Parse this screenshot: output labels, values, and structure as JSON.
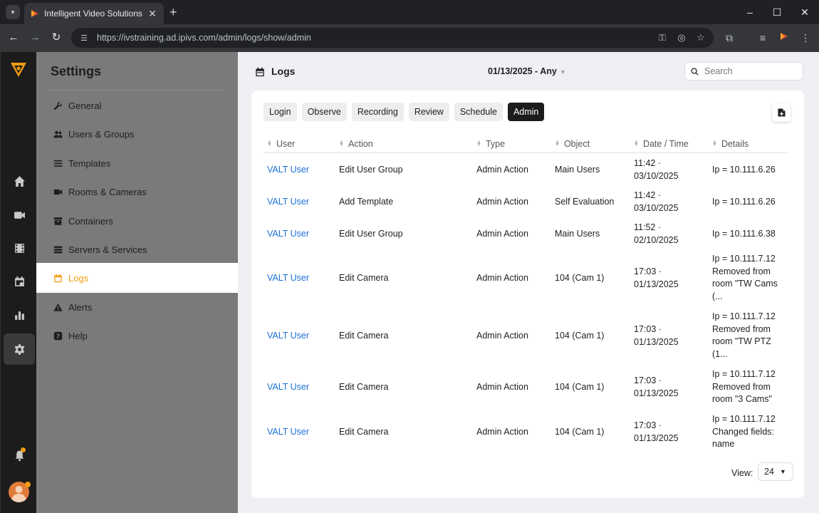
{
  "browser": {
    "tab_title": "Intelligent Video Solutions",
    "url": "https://ivstraining.ad.ipivs.com/admin/logs/show/admin",
    "icons": [
      "tab-dropdown-icon",
      "close-tab-icon",
      "new-tab-icon",
      "minimize-icon",
      "maximize-icon",
      "close-window-icon",
      "back-icon",
      "forward-icon",
      "reload-icon",
      "site-settings-icon",
      "key-icon",
      "eye-off-icon",
      "star-icon",
      "extensions-icon",
      "media-icon",
      "app-icon",
      "menu-icon"
    ]
  },
  "sidebar": {
    "title": "Settings",
    "items": [
      {
        "label": "General",
        "icon": "wrench-icon"
      },
      {
        "label": "Users & Groups",
        "icon": "users-icon"
      },
      {
        "label": "Templates",
        "icon": "list-icon"
      },
      {
        "label": "Rooms & Cameras",
        "icon": "camera-icon"
      },
      {
        "label": "Containers",
        "icon": "archive-icon"
      },
      {
        "label": "Servers & Services",
        "icon": "server-icon"
      },
      {
        "label": "Logs",
        "icon": "calendar-icon",
        "active": true
      },
      {
        "label": "Alerts",
        "icon": "warning-icon"
      },
      {
        "label": "Help",
        "icon": "help-icon"
      }
    ]
  },
  "header": {
    "title": "Logs",
    "date_range": "01/13/2025 - Any",
    "search_placeholder": "Search"
  },
  "tabs": [
    {
      "label": "Login"
    },
    {
      "label": "Observe"
    },
    {
      "label": "Recording"
    },
    {
      "label": "Review"
    },
    {
      "label": "Schedule"
    },
    {
      "label": "Admin",
      "active": true
    }
  ],
  "table": {
    "columns": [
      "User",
      "Action",
      "Type",
      "Object",
      "Date / Time",
      "Details"
    ],
    "rows": [
      {
        "user": "VALT User",
        "action": "Edit User Group",
        "type": "Admin Action",
        "object": "Main Users",
        "time": "11:42 ·",
        "date": "03/10/2025",
        "details": [
          "Ip = 10.111.6.26"
        ]
      },
      {
        "user": "VALT User",
        "action": "Add Template",
        "type": "Admin Action",
        "object": "Self Evaluation",
        "time": "11:42 ·",
        "date": "03/10/2025",
        "details": [
          "Ip = 10.111.6.26"
        ]
      },
      {
        "user": "VALT User",
        "action": "Edit User Group",
        "type": "Admin Action",
        "object": "Main Users",
        "time": "11:52 ·",
        "date": "02/10/2025",
        "details": [
          "Ip = 10.111.6.38"
        ]
      },
      {
        "user": "VALT User",
        "action": "Edit Camera",
        "type": "Admin Action",
        "object": "104 (Cam 1)",
        "time": "17:03 ·",
        "date": "01/13/2025",
        "details": [
          "Ip = 10.111.7.12",
          "Removed from",
          "room \"TW Cams",
          "(..."
        ]
      },
      {
        "user": "VALT User",
        "action": "Edit Camera",
        "type": "Admin Action",
        "object": "104 (Cam 1)",
        "time": "17:03 ·",
        "date": "01/13/2025",
        "details": [
          "Ip = 10.111.7.12",
          "Removed from",
          "room \"TW PTZ",
          "(1..."
        ]
      },
      {
        "user": "VALT User",
        "action": "Edit Camera",
        "type": "Admin Action",
        "object": "104 (Cam 1)",
        "time": "17:03 ·",
        "date": "01/13/2025",
        "details": [
          "Ip = 10.111.7.12",
          "Removed from",
          "room \"3 Cams\""
        ]
      },
      {
        "user": "VALT User",
        "action": "Edit Camera",
        "type": "Admin Action",
        "object": "104 (Cam 1)",
        "time": "17:03 ·",
        "date": "01/13/2025",
        "details": [
          "Ip = 10.111.7.12",
          "Changed fields:",
          "name"
        ]
      }
    ]
  },
  "footer": {
    "view_label": "View:",
    "page_size": "24"
  },
  "colors": {
    "accent": "#f39c12",
    "link": "#1a6fd6",
    "sidebar_bg": "#7a7a7a",
    "rail_bg": "#1c1c1c"
  }
}
